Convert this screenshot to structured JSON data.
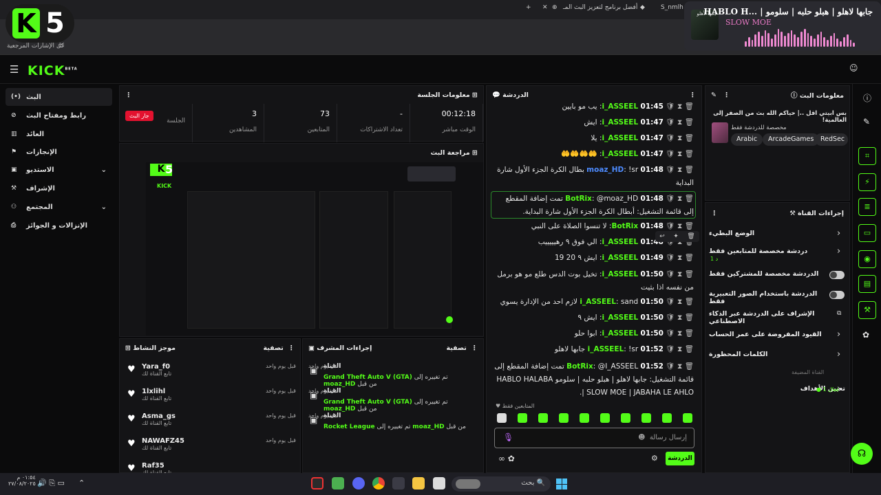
{
  "browser": {
    "tabs": [
      "S_nmlh S",
      "أفضل برنامج لتعزيز البث المـ",
      "⊕"
    ],
    "bookmarks_label": "كل الإشارات المرجعية"
  },
  "overlay": {
    "k": "K",
    "num": "5"
  },
  "media": {
    "title": "HABLO H... | جابها لاهلو | هبلو حلبه | سلومو",
    "artist": "SLOW MOE",
    "art_caption": "جابها لأهلو"
  },
  "header": {
    "logo": "KICK",
    "beta": "BETA"
  },
  "sidebar": {
    "items": [
      {
        "label": "البث",
        "icon": "(•)"
      },
      {
        "label": "رابط ومفتاح البث",
        "icon": "⊘"
      },
      {
        "label": "العائد",
        "icon": "▥"
      },
      {
        "label": "الإنجازات",
        "icon": "⚑"
      },
      {
        "label": "الاستديو",
        "icon": "▣",
        "chev": "⌄"
      },
      {
        "label": "الإشراف",
        "icon": "⚒"
      },
      {
        "label": "المجتمع",
        "icon": "⚇",
        "chev": "⌄"
      },
      {
        "label": "الإنزالات و الجوائز",
        "icon": "⎙"
      }
    ]
  },
  "session": {
    "title": "معلومات الجلسة",
    "live_badge": "جار البث",
    "stats": [
      {
        "value": "00:12:18",
        "label": "الوقت مباشر"
      },
      {
        "value": "-",
        "label": "تعداد الاشتراكات"
      },
      {
        "value": "73",
        "label": "المتابعين"
      },
      {
        "value": "3",
        "label": "المشاهدين"
      },
      {
        "value": "",
        "label": "الجلسة"
      }
    ]
  },
  "preview_title": "مراجعة البث",
  "chat": {
    "title": "الدردشة",
    "messages": [
      {
        "time": "01:45",
        "user": "i_ASSEEL",
        "text": "يب مو بايين"
      },
      {
        "time": "01:47",
        "user": "i_ASSEEL",
        "text": "ايش"
      },
      {
        "time": "01:47",
        "user": "i_ASSEEL",
        "text": "يلا"
      },
      {
        "time": "01:47",
        "user": "i_ASSEEL",
        "text": "🤲🤲🤲🤲"
      },
      {
        "time": "01:48",
        "user": "moaz_HD",
        "text": "!sr بطال الكرة الجزء الأول شارة البداية"
      },
      {
        "time": "01:48",
        "user": "BotRix",
        "text": "@moaz_HD تمت إضافة المقطع إلى قائمة التشغيل: أبطال الكرة الجزء الأول شارة البداية."
      },
      {
        "time": "01:48",
        "user": "BotRix",
        "text": "لا تنسوا الصلاة على النبي"
      },
      {
        "time": "01:48",
        "user": "i_ASSEEL",
        "text": "الي فوق ٩ رهيييييب"
      },
      {
        "time": "01:49",
        "user": "i_ASSEEL",
        "text": "ايش ٩ 20 19"
      },
      {
        "time": "01:50",
        "user": "i_ASSEEL",
        "text": "تخيل بوت الدس طلع مو هو برمل من نفسه اذا بثيت"
      },
      {
        "time": "01:50",
        "user": "i_ASSEEL",
        "text": "sand لازم احد من الإدارة يسوي"
      },
      {
        "time": "01:50",
        "user": "i_ASSEEL",
        "text": "ايش ٩"
      },
      {
        "time": "01:50",
        "user": "i_ASSEEL",
        "text": "ابوا حلو"
      },
      {
        "time": "01:52",
        "user": "i_ASSEEL",
        "text": "!sr جابها لاهلو"
      },
      {
        "time": "01:52",
        "user": "BotRix",
        "text": "@I_ASSEEL تمت إضافة المقطع إلى قائمة التشغيل: جابها لاهلو | هبلو حلبه | سلومو HABLO HALABA | SLOW MOE | JABAHA LE AHLO."
      }
    ],
    "followers_only": "المتابعين فقط",
    "input_placeholder": "إرسال رسالة",
    "send_label": "الدردشة"
  },
  "stream_info": {
    "title": "معلومات البث",
    "stream_title": "بس ابيتي اقل ..| حياكم الله بث من الصفر إلى العالمية!",
    "category": "مخصصة للدردشة فقط",
    "tags": [
      "Arabic",
      "ArcadeGames",
      "RedSec"
    ]
  },
  "channel_actions": {
    "title": "إجراءات القناة",
    "items": [
      {
        "label": "الوضع البطيء",
        "type": "chev"
      },
      {
        "label": "دردشة مخصصة للمتابعين فقط",
        "sub": "1 د",
        "type": "chev"
      },
      {
        "label": "الدردشة مخصصة للمشتركين فقط",
        "type": "toggle"
      },
      {
        "label": "الدردشة باستخدام الصور التعبيرية فقط",
        "type": "toggle"
      },
      {
        "label": "الإشراف على الدردشة عبر الذكاء الاصطناعي",
        "type": "ext"
      },
      {
        "label": "القيود المفروضة على عمر الحساب",
        "type": "chev"
      },
      {
        "label": "الكلمات المحظورة",
        "type": "chev"
      }
    ],
    "goals_header": "القناة المضيفة",
    "goals": "تعيين الأهداف",
    "goals_sub": "فعال 1"
  },
  "activity": {
    "title": "موجز النشاط",
    "filter": "تصفية",
    "items": [
      {
        "name": "Yara_f0",
        "sub": "تابع القناة لك",
        "ago": "قبل يوم واحد"
      },
      {
        "name": "1lxlihl",
        "sub": "تابع القناة لك",
        "ago": "قبل يوم واحد"
      },
      {
        "name": "Asma_gs",
        "sub": "تابع القناة لك",
        "ago": "قبل يوم واحد"
      },
      {
        "name": "NAWAFZ45",
        "sub": "تابع القناة لك",
        "ago": "قبل يوم واحد"
      },
      {
        "name": "Raf35",
        "sub": "تابع القناة لك",
        "ago": ""
      }
    ]
  },
  "mod_actions": {
    "title": "إجراءات المشرف",
    "filter": "تصفية",
    "items": [
      {
        "title": "القناة",
        "user": "moaz_HD",
        "pre": "تم تغييره إلى",
        "game": "Grand Theft Auto V (GTA)",
        "by": "من قبل",
        "ago": "قبل يوم واحد"
      },
      {
        "title": "القناة",
        "user": "moaz_HD",
        "pre": "تم تغييره إلى",
        "game": "Grand Theft Auto V (GTA)",
        "by": "من قبل",
        "ago": "قبل يوم واحد"
      },
      {
        "title": "القناة",
        "user": "moaz_HD",
        "pre": "تم تغييره إلى",
        "game": "Rocket League",
        "by": "من قبل",
        "ago": "قبل يوم واحد"
      }
    ]
  },
  "taskbar": {
    "search": "بحث",
    "time": "٠١:٥٤ م",
    "date": "٢٧/٠٨/٢٠٢٥"
  },
  "colors": {
    "accent": "#53fc18",
    "live": "#e3122f",
    "bg": "#0b0b0c",
    "panel": "#141416"
  }
}
